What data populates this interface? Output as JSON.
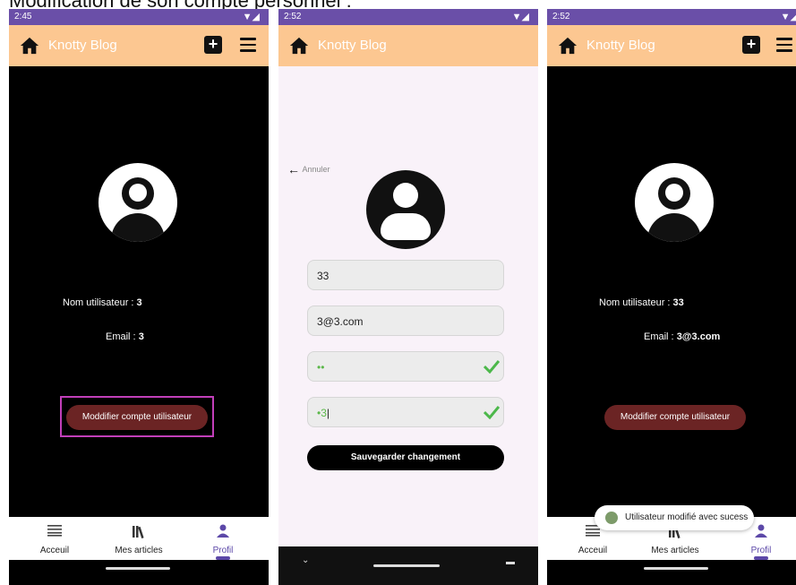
{
  "caption": "Modification de son compte personnel :",
  "accent": "#fcc791",
  "screens": [
    {
      "time": "2:45",
      "app_title": "Knotty Blog",
      "username_label": "Nom utilisateur : ",
      "username_value": "3",
      "email_label": "Email : ",
      "email_value": "3",
      "edit_button": "Moddifier compte utilisateur",
      "nav": [
        "Acceuil",
        "Mes articles",
        "Profil"
      ]
    },
    {
      "time": "2:52",
      "app_title": "Knotty Blog",
      "cancel_label": "Annuler",
      "username_input": "33",
      "email_input": "3@3.com",
      "password_input": "••",
      "confirm_input": "•3",
      "save_button": "Sauvegarder changement"
    },
    {
      "time": "2:52",
      "app_title": "Knotty Blog",
      "username_label": "Nom utilisateur : ",
      "username_value": "33",
      "email_label": "Email : ",
      "email_value": "3@3.com",
      "edit_button": "Moddifier compte utilisateur",
      "toast": "Utilisateur modifié avec sucess",
      "nav": [
        "Acceuil",
        "Mes articles",
        "Profil"
      ]
    }
  ]
}
